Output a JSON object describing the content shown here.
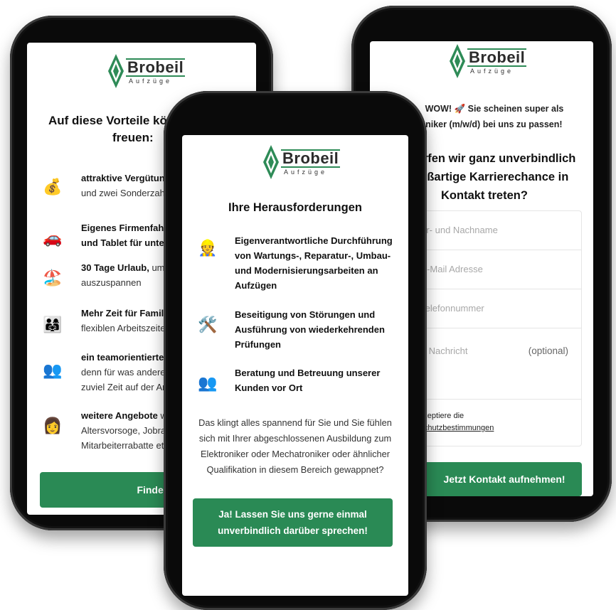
{
  "brand": {
    "name": "Brobeil",
    "subtitle": "Aufzüge",
    "accent_color": "#2a8a55"
  },
  "left_phone": {
    "heading_line1": "Auf diese Vorteile könn",
    "heading_line2": "freuen:",
    "benefits": [
      {
        "icon": "money-bag-icon",
        "bold": "attraktive Vergütung,",
        "rest": "und zwei Sonderzahl"
      },
      {
        "icon": "car-icon",
        "bold": "Eigenes Firmenfahrz",
        "rest": "und Tablet für unterw"
      },
      {
        "icon": "beach-icon",
        "bold": "30 Tage Urlaub,",
        "rest1": " um e",
        "rest": "auszuspannen"
      },
      {
        "icon": "family-icon",
        "bold": "Mehr Zeit für Familie",
        "rest": "flexiblen Arbeitszeiten"
      },
      {
        "icon": "people-icon",
        "bold": "ein teamorientiertes",
        "rest": "denn für was anderes",
        "rest2": "zuviel Zeit auf der Arb"
      },
      {
        "icon": "woman-icon",
        "bold": "weitere Angebote",
        "rest1": " wie",
        "rest": "Altersvorsoge, Jobrad",
        "rest2": "Mitarbeiterrabatte etc"
      }
    ],
    "cta": "Finde ich gut"
  },
  "center_phone": {
    "heading": "Ihre Herausforderungen",
    "items": [
      {
        "icon": "construction-worker-icon",
        "lines": [
          "Eigenverantwortliche Durchführung",
          "von Wartungs-, Reparatur-, Umbau-",
          "und Modernisierungsarbeiten an",
          "Aufzügen"
        ]
      },
      {
        "icon": "tools-icon",
        "lines": [
          "Beseitigung von Störungen und",
          "Ausführung von wiederkehrenden",
          "Prüfungen"
        ]
      },
      {
        "icon": "busts-icon",
        "lines": [
          "Beratung und Betreuung unserer",
          "Kunden vor Ort"
        ]
      }
    ],
    "paragraph_lines": [
      "Das klingt alles spannend für Sie und Sie fühlen",
      "sich mit Ihrer abgeschlossenen Ausbildung zum",
      "Elektroniker oder Mechatroniker oder ähnlicher",
      "Qualifikation in diesem Bereich gewappnet?"
    ],
    "cta_line1": "Ja! Lassen Sie uns gerne einmal",
    "cta_line2": "unverbindlich darüber sprechen!"
  },
  "right_phone": {
    "intro_line1": "WOW! 🚀 Sie scheinen super als",
    "intro_line2": "etechniker (m/w/d) bei uns zu passen!",
    "heading_line1": "n dürfen wir ganz unverbindlich",
    "heading_line2": "e großartige Karrierechance in",
    "heading_line3": "Kontakt treten?",
    "fields": {
      "name_placeholder": "hr Vor- und Nachname",
      "email_placeholder": "hre E-Mail Adresse",
      "phone_placeholder": "hre Telefonnummer",
      "message_placeholder": "Deine Nachricht",
      "optional_label": "(optional)"
    },
    "consent_line1": "ch akzeptiere die",
    "consent_link": "atenschutzbestimmungen",
    "cta": "Jetzt Kontakt aufnehmen!"
  }
}
